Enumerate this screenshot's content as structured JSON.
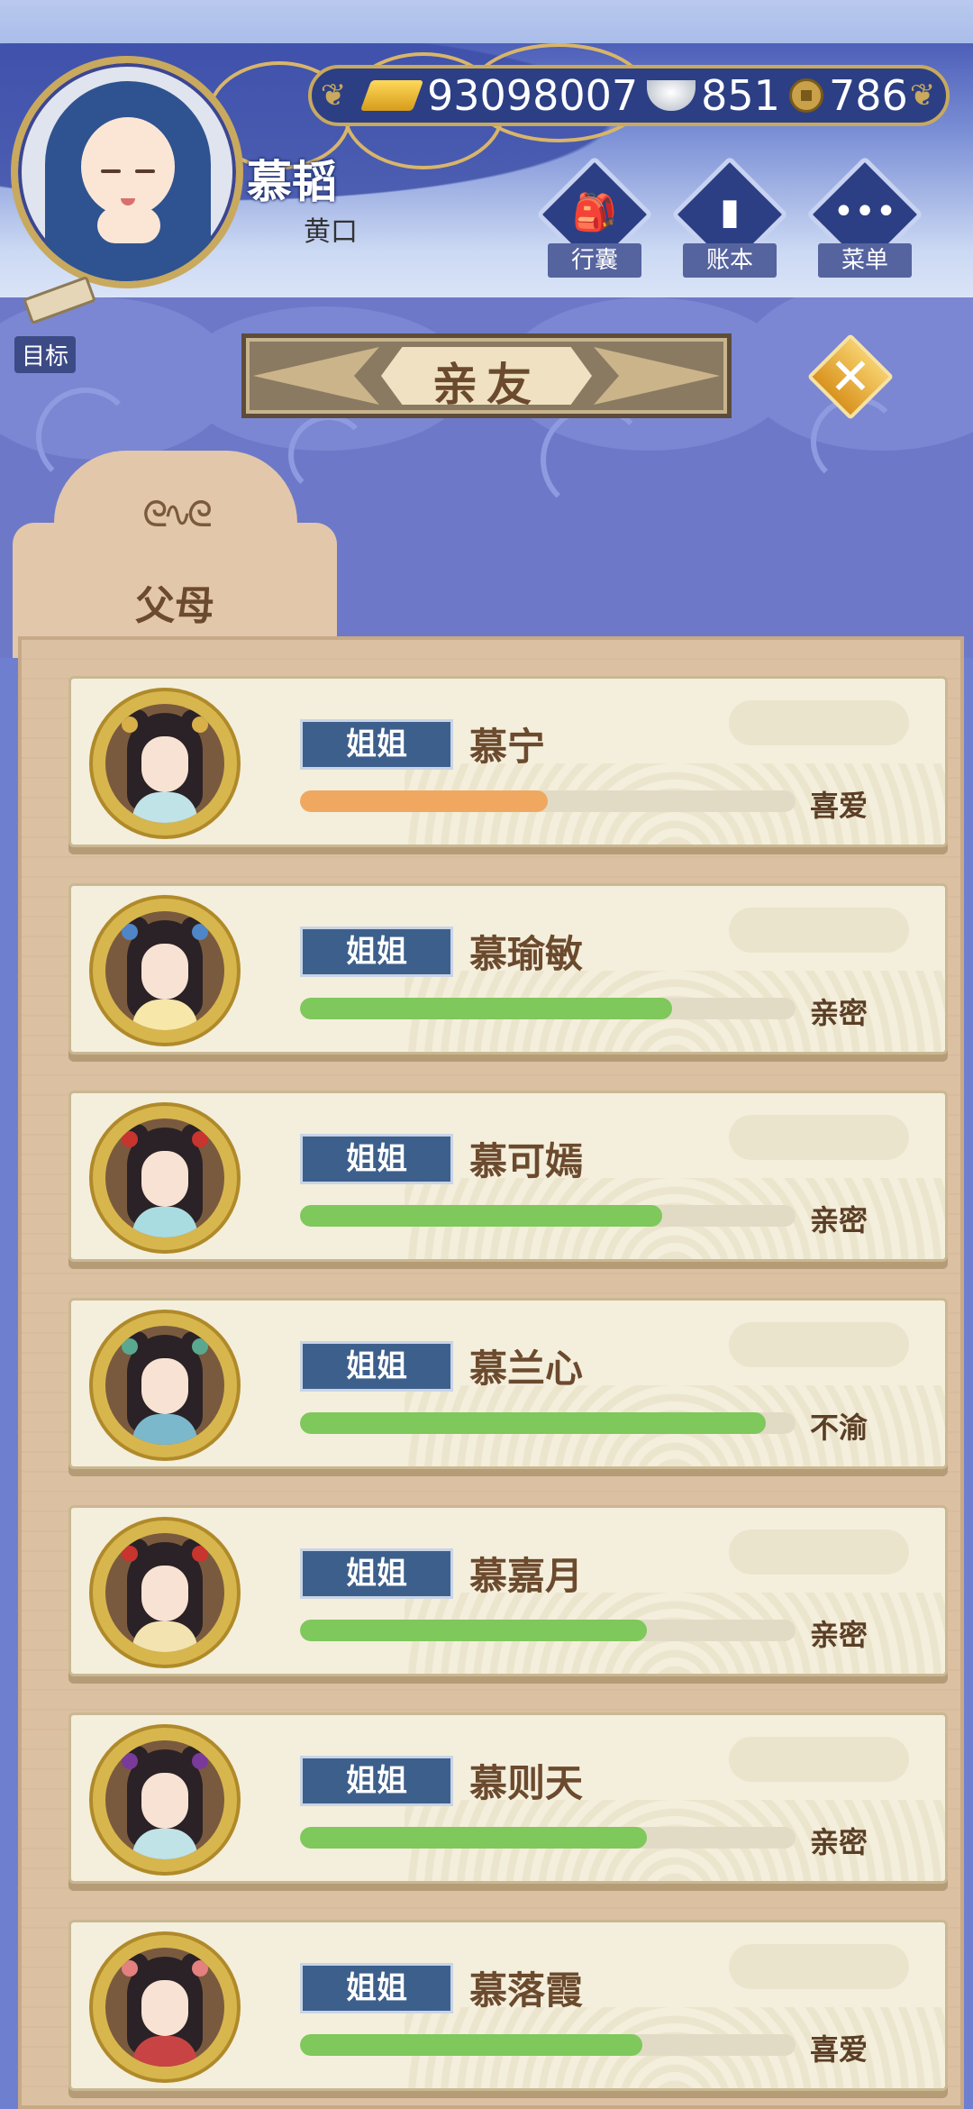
{
  "player": {
    "name": "慕韬",
    "title": "黄口"
  },
  "goal": {
    "label": "目标"
  },
  "currency": {
    "gold": "93098007",
    "silver": "851",
    "coins": "786"
  },
  "menu": [
    {
      "label": "行囊",
      "icon": "bag-icon"
    },
    {
      "label": "账本",
      "icon": "ledger-icon"
    },
    {
      "label": "菜单",
      "icon": "more-icon"
    }
  ],
  "page_title": "亲友",
  "tab": {
    "label": "父母"
  },
  "colors": {
    "fill_orange": "#f0a860",
    "fill_green": "#7ec85c"
  },
  "relatives": [
    {
      "relation": "姐姐",
      "name": "慕宁",
      "status": "喜爱",
      "favor": 0.5,
      "color": "#f0a860",
      "dress": "#bfe3e7",
      "orn": "#d8b04a"
    },
    {
      "relation": "姐姐",
      "name": "慕瑜敏",
      "status": "亲密",
      "favor": 0.75,
      "color": "#7ec85c",
      "dress": "#f7e7a8",
      "orn": "#4f86c8"
    },
    {
      "relation": "姐姐",
      "name": "慕可嫣",
      "status": "亲密",
      "favor": 0.73,
      "color": "#7ec85c",
      "dress": "#a9dce0",
      "orn": "#c8342e"
    },
    {
      "relation": "姐姐",
      "name": "慕兰心",
      "status": "不渝",
      "favor": 0.94,
      "color": "#7ec85c",
      "dress": "#7cb8cc",
      "orn": "#5aa890"
    },
    {
      "relation": "姐姐",
      "name": "慕嘉月",
      "status": "亲密",
      "favor": 0.7,
      "color": "#7ec85c",
      "dress": "#f3e3b0",
      "orn": "#c8342e"
    },
    {
      "relation": "姐姐",
      "name": "慕则天",
      "status": "亲密",
      "favor": 0.7,
      "color": "#7ec85c",
      "dress": "#bfe3e7",
      "orn": "#7a3a9a"
    },
    {
      "relation": "姐姐",
      "name": "慕落霞",
      "status": "喜爱",
      "favor": 0.69,
      "color": "#7ec85c",
      "dress": "#c84444",
      "orn": "#e48080"
    }
  ]
}
